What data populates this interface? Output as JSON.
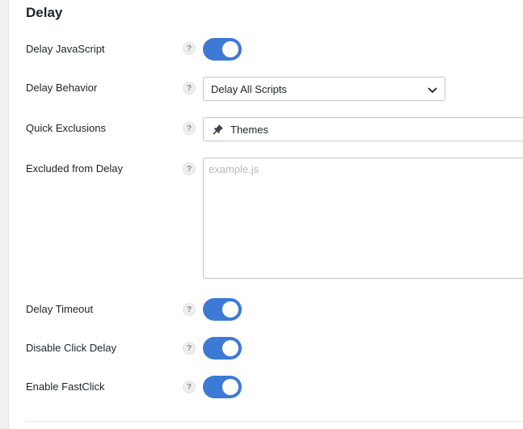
{
  "section": {
    "title": "Delay"
  },
  "colors": {
    "accent": "#3d7ad6",
    "knob": "#ffffff"
  },
  "rows": {
    "delay_js": {
      "label": "Delay JavaScript",
      "toggle_on": true
    },
    "delay_behavior": {
      "label": "Delay Behavior",
      "selected": "Delay All Scripts"
    },
    "quick_exclusions": {
      "label": "Quick Exclusions",
      "selected": "Themes",
      "icon": "pin-icon"
    },
    "excluded": {
      "label": "Excluded from Delay",
      "placeholder": "example.js",
      "value": ""
    },
    "delay_timeout": {
      "label": "Delay Timeout",
      "toggle_on": true
    },
    "disable_click_delay": {
      "label": "Disable Click Delay",
      "toggle_on": true
    },
    "enable_fastclick": {
      "label": "Enable FastClick",
      "toggle_on": true
    }
  },
  "help_glyph": "?"
}
